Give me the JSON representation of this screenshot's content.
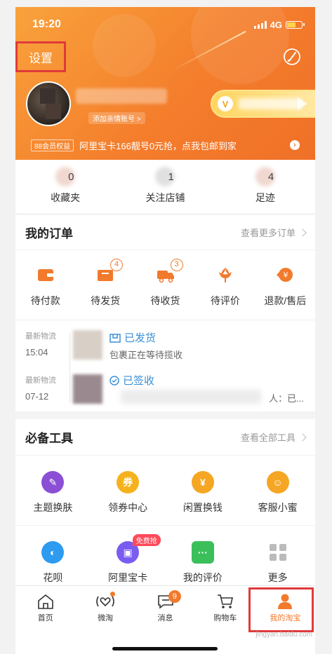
{
  "status": {
    "time": "19:20",
    "network": "4G"
  },
  "header": {
    "settings_label": "设置",
    "family_tag": "添加亲情账号 >",
    "member_badge": "88会员权益",
    "member_text": "阿里宝卡166靓号0元抢，点我包邮到家"
  },
  "stats": [
    {
      "label": "收藏夹",
      "digit": "0"
    },
    {
      "label": "关注店铺",
      "digit": "1"
    },
    {
      "label": "足迹",
      "digit": "4"
    }
  ],
  "orders": {
    "title": "我的订单",
    "more": "查看更多订单",
    "items": [
      {
        "label": "待付款",
        "badge": ""
      },
      {
        "label": "待发货",
        "badge": "4"
      },
      {
        "label": "待收货",
        "badge": "3"
      },
      {
        "label": "待评价",
        "badge": ""
      },
      {
        "label": "退款/售后",
        "badge": ""
      }
    ],
    "logistics": [
      {
        "meta": "最新物流",
        "time": "15:04",
        "status": "已发货",
        "desc": "包裹正在等待揽收",
        "tail": ""
      },
      {
        "meta": "最新物流",
        "time": "07-12",
        "status": "已签收",
        "desc": "",
        "tail": "人：已..."
      }
    ]
  },
  "tools": {
    "title": "必备工具",
    "more": "查看全部工具",
    "row1": [
      {
        "label": "主题换肤",
        "icon": "palette-icon",
        "color": "#8b4fd6"
      },
      {
        "label": "领券中心",
        "icon": "coupon-icon",
        "color": "#f5b21a"
      },
      {
        "label": "闲置换钱",
        "icon": "yuan-icon",
        "color": "#f5a623"
      },
      {
        "label": "客服小蜜",
        "icon": "service-icon",
        "color": "#f5a623"
      }
    ],
    "row2": [
      {
        "label": "花呗",
        "icon": "huabei-icon",
        "color": "#2d9bf0"
      },
      {
        "label": "阿里宝卡",
        "icon": "simcard-icon",
        "color": "#7a5cf0"
      },
      {
        "label": "我的评价",
        "icon": "comment-icon",
        "color": "#3bbf5b"
      },
      {
        "label": "更多",
        "icon": "grid-icon",
        "color": "#bbbbbb"
      }
    ],
    "free_tag": "免费抢"
  },
  "tabbar": {
    "items": [
      {
        "label": "首页"
      },
      {
        "label": "微淘"
      },
      {
        "label": "消息",
        "badge": "9"
      },
      {
        "label": "购物车"
      },
      {
        "label": "我的淘宝"
      }
    ]
  },
  "watermark": "jingyan.baidu.com"
}
